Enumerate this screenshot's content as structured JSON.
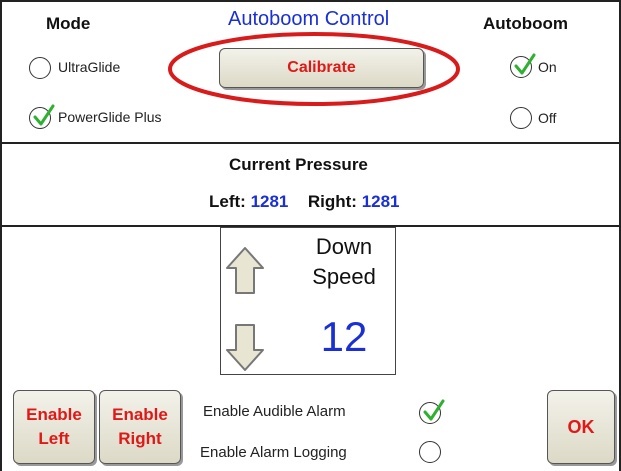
{
  "header": {
    "mode_label": "Mode",
    "title": "Autoboom Control",
    "autoboom_label": "Autoboom"
  },
  "mode": {
    "options": [
      {
        "label": "UltraGlide",
        "selected": false
      },
      {
        "label": "PowerGlide Plus",
        "selected": true
      }
    ]
  },
  "calibrate": {
    "label": "Calibrate"
  },
  "autoboom": {
    "options": [
      {
        "label": "On",
        "selected": true
      },
      {
        "label": "Off",
        "selected": false
      }
    ]
  },
  "pressure": {
    "title": "Current Pressure",
    "left_label": "Left:",
    "left_value": "1281",
    "right_label": "Right:",
    "right_value": "1281"
  },
  "speed": {
    "title_line1": "Down",
    "title_line2": "Speed",
    "value": "12"
  },
  "footer": {
    "enable_left_line1": "Enable",
    "enable_left_line2": "Left",
    "enable_right_line1": "Enable",
    "enable_right_line2": "Right",
    "audible_alarm_label": "Enable Audible Alarm",
    "audible_alarm_checked": true,
    "alarm_logging_label": "Enable Alarm Logging",
    "alarm_logging_checked": false,
    "ok_label": "OK"
  },
  "colors": {
    "accent_blue": "#1a2fd6",
    "button_text_red": "#e01818",
    "check_green": "#2fb02f",
    "highlight_ellipse": "#d81b1b"
  }
}
